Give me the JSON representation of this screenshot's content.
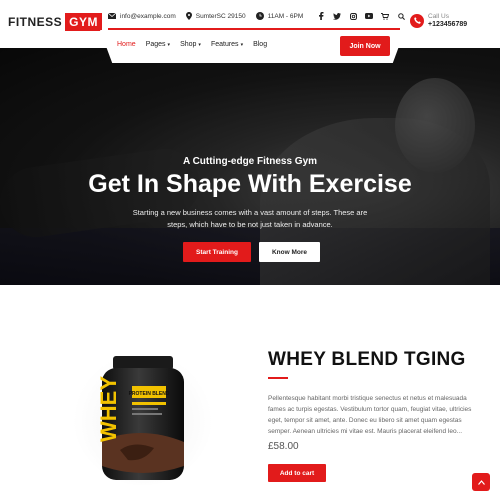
{
  "logo": {
    "part1": "FITNESS",
    "part2": "GYM"
  },
  "topbar": {
    "email": "info@example.com",
    "location": "SumterSC 29150",
    "hours": "11AM - 6PM",
    "socials": [
      "facebook-icon",
      "twitter-icon",
      "instagram-icon",
      "youtube-icon",
      "cart-icon",
      "search-icon"
    ]
  },
  "nav": {
    "items": [
      {
        "label": "Home",
        "active": true,
        "dropdown": false
      },
      {
        "label": "Pages",
        "active": false,
        "dropdown": true
      },
      {
        "label": "Shop",
        "active": false,
        "dropdown": true
      },
      {
        "label": "Features",
        "active": false,
        "dropdown": true
      },
      {
        "label": "Blog",
        "active": false,
        "dropdown": false
      }
    ],
    "cta": "Join Now"
  },
  "call": {
    "label": "Call Us",
    "number": "+123456789"
  },
  "hero": {
    "subtitle": "A Cutting-edge Fitness Gym",
    "title": "Get In Shape With Exercise",
    "description": "Starting a new business comes with a vast amount of steps. These are steps, which have to be not just taken in advance.",
    "primary_button": "Start Training",
    "secondary_button": "Know More",
    "slides": [
      {
        "active": true
      },
      {
        "active": false
      }
    ]
  },
  "product": {
    "title": "WHEY BLEND TGING",
    "description": "Pellentesque habitant morbi tristique senectus et netus et malesuada fames ac turpis egestas. Vestibulum tortor quam, feugiat vitae, ultricies eget, tempor sit amet, ante. Donec eu libero sit amet quam egestas semper. Aenean ultricies mi vitae est. Mauris placerat eleifend leo...",
    "price": "£58.00",
    "button": "Add to cart",
    "jar_label_main": "WHEY",
    "jar_label_sub": "PROTEIN BLEND"
  },
  "colors": {
    "accent": "#e21b1b",
    "text": "#111111",
    "muted": "#666666"
  }
}
